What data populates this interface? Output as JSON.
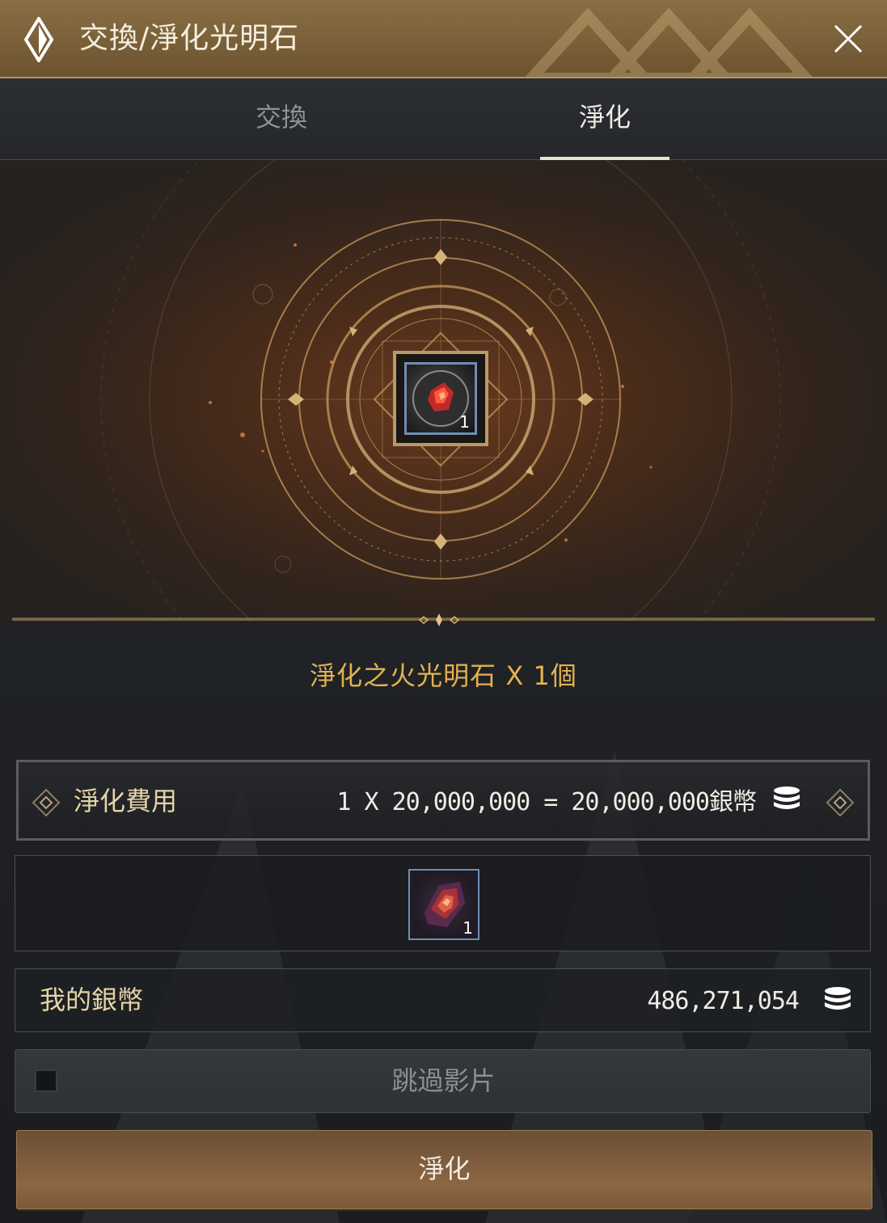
{
  "window": {
    "title": "交換/淨化光明石",
    "close_icon": "close-icon",
    "title_icon": "diamond-icon"
  },
  "tabs": [
    {
      "label": "交換",
      "active": false
    },
    {
      "label": "淨化",
      "active": true
    }
  ],
  "center_item": {
    "icon": "bright-stone-icon",
    "count": "1"
  },
  "result": {
    "text": "淨化之火光明石 X 1個"
  },
  "cost": {
    "label": "淨化費用",
    "value": "1 X 20,000,000 = 20,000,000銀幣",
    "icon": "silver-coin-icon"
  },
  "material": {
    "icon": "fire-crystal-icon",
    "count": "1"
  },
  "my_silver": {
    "label": "我的銀幣",
    "value": "486,271,054",
    "icon": "silver-coin-icon"
  },
  "skip_video": {
    "label": "跳過影片",
    "checked": false
  },
  "action": {
    "label": "淨化"
  },
  "colors": {
    "accent_gold": "#e3b250",
    "title_bar": "#8a6f45",
    "button": "#8d6742"
  }
}
